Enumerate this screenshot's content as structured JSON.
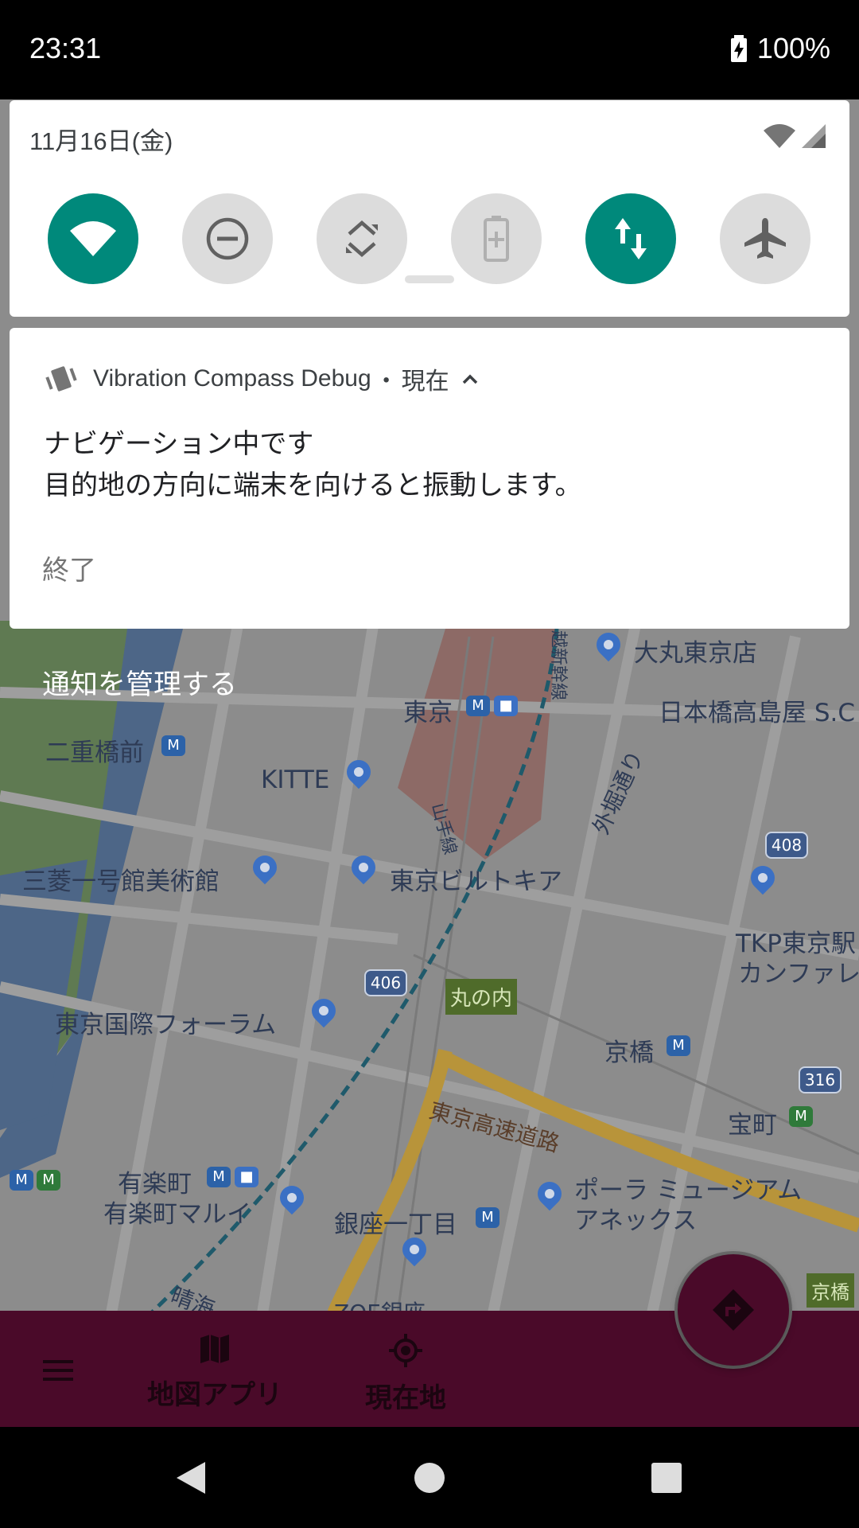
{
  "status_bar": {
    "time": "23:31",
    "battery": "100%"
  },
  "quick_settings": {
    "date": "11月16日(金)",
    "tiles": [
      {
        "name": "wifi",
        "state": "on"
      },
      {
        "name": "do-not-disturb",
        "state": "off"
      },
      {
        "name": "auto-rotate",
        "state": "off"
      },
      {
        "name": "battery-saver",
        "state": "disabled"
      },
      {
        "name": "mobile-data",
        "state": "on"
      },
      {
        "name": "airplane-mode",
        "state": "off"
      }
    ]
  },
  "notification": {
    "app_name": "Vibration Compass Debug",
    "separator": "・",
    "time": "現在",
    "title": "ナビゲーション中です",
    "text": "目的地の方向に端末を向けると振動します。",
    "action": "終了"
  },
  "manage_notifications": "通知を管理する",
  "map": {
    "labels": {
      "daimaru": "大丸東京店",
      "takashimaya": "日本橋高島屋 S.C",
      "tokyo": "東京",
      "nijubashimae": "二重橋前",
      "kitte": "KITTE",
      "sotobori": "外堀通り",
      "yamanote": "山手線",
      "shinkansen": "越新幹線",
      "mitsubishi": "三菱一号館美術館",
      "tokia": "東京ビルトキア",
      "tkp1": "TKP東京駅",
      "tkp2": "カンファレ",
      "forum": "東京国際フォーラム",
      "marunouchi": "丸の内",
      "kyobashi": "京橋",
      "expressway": "東京高速道路",
      "takaracho": "宝町",
      "yurakucho": "有楽町",
      "marui": "有楽町マルイ",
      "ginza1": "銀座一丁目",
      "pola1": "ポーラ ミュージアム",
      "pola2": "アネックス",
      "kyobashi_tag": "京橋",
      "harumi": "晴海",
      "zoe": "ZOE銀座",
      "r406": "406",
      "r408": "408",
      "r316": "316"
    }
  },
  "bottom_bar": {
    "map_app": "地図アプリ",
    "current_location": "現在地"
  },
  "colors": {
    "accent_teal": "#00897b",
    "app_bar": "#4a0a29"
  }
}
